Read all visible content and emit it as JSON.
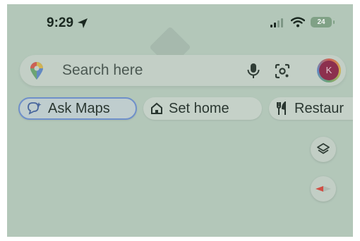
{
  "status_bar": {
    "time": "9:29",
    "battery": "24"
  },
  "search": {
    "placeholder": "Search here"
  },
  "avatar": {
    "initial": "K"
  },
  "chips": [
    {
      "label": "Ask Maps",
      "icon": "ask-maps-icon"
    },
    {
      "label": "Set home",
      "icon": "home-icon"
    },
    {
      "label": "Restaur",
      "icon": "restaurant-icon"
    }
  ],
  "map_controls": {
    "layers_icon": "layers-icon",
    "compass_icon": "compass-icon"
  },
  "colors": {
    "map_background": "#b7cbbd",
    "accent_blue": "#6b8ed0",
    "avatar_bg": "#8c2346"
  }
}
